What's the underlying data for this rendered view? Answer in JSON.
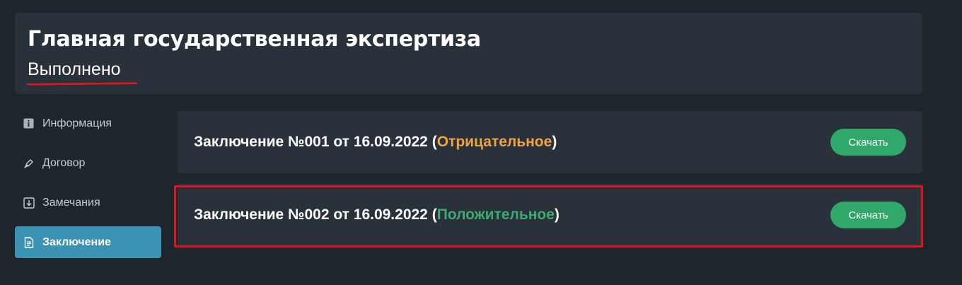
{
  "header": {
    "title": "Главная государственная экспертиза",
    "status": "Выполнено"
  },
  "sidebar": {
    "items": [
      {
        "label": "Информация",
        "icon": "info-icon",
        "active": false
      },
      {
        "label": "Договор",
        "icon": "pen-icon",
        "active": false
      },
      {
        "label": "Замечания",
        "icon": "download-box-icon",
        "active": false
      },
      {
        "label": "Заключение",
        "icon": "document-icon",
        "active": true
      }
    ]
  },
  "conclusions": [
    {
      "title": "Заключение №001 от 16.09.2022 (",
      "verdict": "Отрицательное",
      "closing": ")",
      "button_label": "Скачать",
      "verdict_color": "#f0a440"
    },
    {
      "title": "Заключение №002 от 16.09.2022 (",
      "verdict": "Положительное",
      "closing": ")",
      "button_label": "Скачать",
      "verdict_color": "#3eab6e"
    }
  ],
  "colors": {
    "background": "#1f252d",
    "card": "#29313b",
    "accent_active": "#3a93b3",
    "button": "#2fa86a",
    "highlight": "#e0141b"
  }
}
